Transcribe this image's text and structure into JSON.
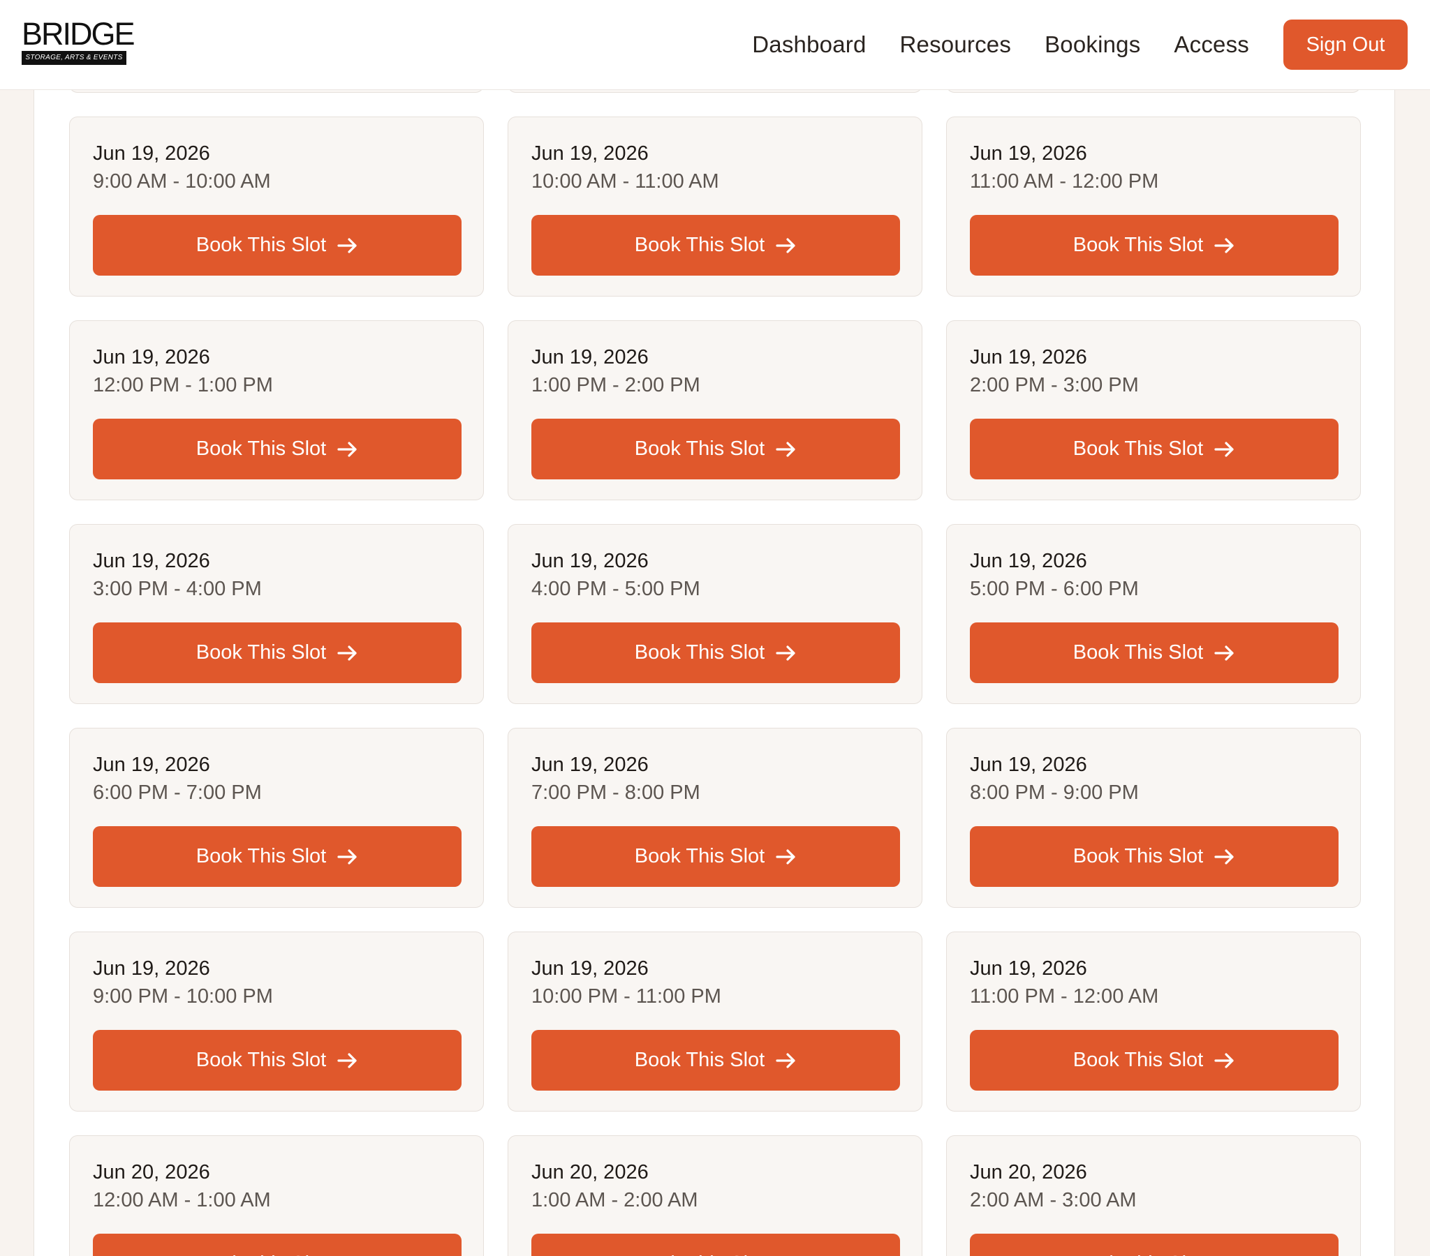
{
  "header": {
    "logo_word": "BRIDGE",
    "logo_tagline": "STORAGE, ARTS & EVENTS",
    "nav": [
      "Dashboard",
      "Resources",
      "Bookings",
      "Access"
    ],
    "sign_out": "Sign Out"
  },
  "book_label": "Book This Slot",
  "slots": [
    {
      "date": "",
      "time": ""
    },
    {
      "date": "",
      "time": ""
    },
    {
      "date": "",
      "time": ""
    },
    {
      "date": "Jun 19, 2026",
      "time": "9:00 AM - 10:00 AM"
    },
    {
      "date": "Jun 19, 2026",
      "time": "10:00 AM - 11:00 AM"
    },
    {
      "date": "Jun 19, 2026",
      "time": "11:00 AM - 12:00 PM"
    },
    {
      "date": "Jun 19, 2026",
      "time": "12:00 PM - 1:00 PM"
    },
    {
      "date": "Jun 19, 2026",
      "time": "1:00 PM - 2:00 PM"
    },
    {
      "date": "Jun 19, 2026",
      "time": "2:00 PM - 3:00 PM"
    },
    {
      "date": "Jun 19, 2026",
      "time": "3:00 PM - 4:00 PM"
    },
    {
      "date": "Jun 19, 2026",
      "time": "4:00 PM - 5:00 PM"
    },
    {
      "date": "Jun 19, 2026",
      "time": "5:00 PM - 6:00 PM"
    },
    {
      "date": "Jun 19, 2026",
      "time": "6:00 PM - 7:00 PM"
    },
    {
      "date": "Jun 19, 2026",
      "time": "7:00 PM - 8:00 PM"
    },
    {
      "date": "Jun 19, 2026",
      "time": "8:00 PM - 9:00 PM"
    },
    {
      "date": "Jun 19, 2026",
      "time": "9:00 PM - 10:00 PM"
    },
    {
      "date": "Jun 19, 2026",
      "time": "10:00 PM - 11:00 PM"
    },
    {
      "date": "Jun 19, 2026",
      "time": "11:00 PM - 12:00 AM"
    },
    {
      "date": "Jun 20, 2026",
      "time": "12:00 AM - 1:00 AM"
    },
    {
      "date": "Jun 20, 2026",
      "time": "1:00 AM - 2:00 AM"
    },
    {
      "date": "Jun 20, 2026",
      "time": "2:00 AM - 3:00 AM"
    }
  ],
  "colors": {
    "accent": "#e0582c",
    "page_bg": "#f8f3ef",
    "card_bg": "#f9f6f3"
  }
}
